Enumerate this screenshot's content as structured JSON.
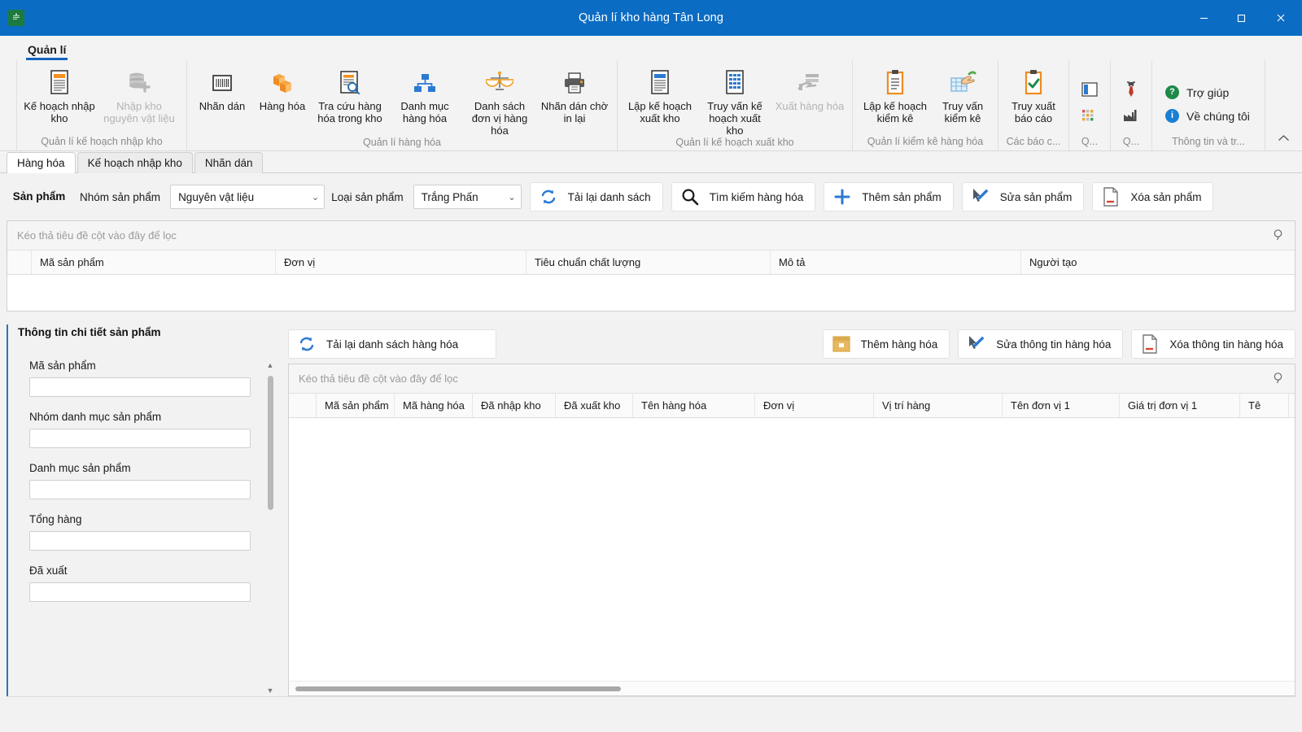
{
  "window": {
    "title": "Quản lí kho hàng Tân Long",
    "app_icon": "warehouse-app-icon",
    "minimize": "–",
    "maximize": "▢",
    "close": "✕",
    "accent": "#0b6cc4"
  },
  "ribbon": {
    "tabs": [
      {
        "label": "Quản lí",
        "active": true
      }
    ],
    "collapse_label": "^",
    "groups": [
      {
        "title": "Quản lí kế hoạch nhập kho",
        "buttons": [
          {
            "label": "Kế hoạch nhập kho",
            "icon": "document-orange-icon",
            "disabled": false
          },
          {
            "label": "Nhập kho nguyên vật liệu",
            "icon": "database-add-icon",
            "disabled": true
          }
        ]
      },
      {
        "title": "Quản lí hàng hóa",
        "buttons": [
          {
            "label": "Nhãn dán",
            "icon": "barcode-icon",
            "disabled": false
          },
          {
            "label": "Hàng hóa",
            "icon": "boxes-icon",
            "disabled": false
          },
          {
            "label": "Tra cứu hàng hóa trong kho",
            "icon": "document-search-icon",
            "disabled": false
          },
          {
            "label": "Danh mục hàng hóa",
            "icon": "hierarchy-icon",
            "disabled": false
          },
          {
            "label": "Danh sách đơn vị hàng hóa",
            "icon": "scale-balance-icon",
            "disabled": false
          },
          {
            "label": "Nhãn dán chờ in lại",
            "icon": "printer-icon",
            "disabled": false
          }
        ]
      },
      {
        "title": "Quản lí kế hoạch xuất kho",
        "buttons": [
          {
            "label": "Lập kế hoạch xuất kho",
            "icon": "document-blue-icon",
            "disabled": false
          },
          {
            "label": "Truy vấn kế hoạch xuất kho",
            "icon": "grid-document-icon",
            "disabled": false
          },
          {
            "label": "Xuất hàng hóa",
            "icon": "hand-export-icon",
            "disabled": true
          }
        ]
      },
      {
        "title": "Quản lí kiểm kê hàng hóa",
        "buttons": [
          {
            "label": "Lập kế hoạch kiểm kê",
            "icon": "clipboard-list-icon",
            "disabled": false
          },
          {
            "label": "Truy vấn kiểm kê",
            "icon": "hand-table-icon",
            "disabled": false
          }
        ]
      },
      {
        "title": "Các báo c...",
        "buttons": [
          {
            "label": "Truy xuất báo cáo",
            "icon": "clipboard-check-icon",
            "disabled": false
          }
        ]
      }
    ],
    "mini_groups": [
      {
        "title": "Q...",
        "icons": [
          "layout-panel-icon",
          "color-palette-icon"
        ]
      },
      {
        "title": "Q...",
        "icons": [
          "tie-icon",
          "factory-icon"
        ]
      }
    ],
    "info_group": {
      "title": "Thông tin và tr...",
      "items": [
        {
          "label": "Trợ giúp",
          "icon": "help-question-icon",
          "color": "#1d8a4a"
        },
        {
          "label": "Về chúng tôi",
          "icon": "info-circle-icon",
          "color": "#1a7fd4"
        }
      ]
    }
  },
  "doc_tabs": [
    {
      "label": "Hàng hóa",
      "active": true
    },
    {
      "label": "Kế hoạch nhập kho",
      "active": false
    },
    {
      "label": "Nhãn dán",
      "active": false
    }
  ],
  "product_toolbar": {
    "section_title": "Sản phẩm",
    "group_label": "Nhóm sản phẩm",
    "group_value": "Nguyên vật liệu",
    "type_label": "Loại sản phẩm",
    "type_value": "Trắng Phấn",
    "chevron": "⌄",
    "buttons": [
      {
        "label": "Tải lại danh sách",
        "icon": "refresh-icon"
      },
      {
        "label": "Tìm kiếm hàng hóa",
        "icon": "search-icon"
      },
      {
        "label": "Thêm sản phẩm",
        "icon": "plus-icon"
      },
      {
        "label": "Sửa sản phẩm",
        "icon": "edit-pencil-icon"
      },
      {
        "label": "Xóa sản phẩm",
        "icon": "delete-document-icon"
      }
    ]
  },
  "product_grid": {
    "filter_hint": "Kéo thả tiêu đề cột vào đây để lọc",
    "find_icon": "find-icon",
    "columns": [
      "Mã sản phẩm",
      "Đơn vị",
      "Tiêu chuẩn chất lượng",
      "Mô tả",
      "Người tạo"
    ],
    "rows": []
  },
  "detail_panel": {
    "title": "Thông tin chi tiết sản phẩm",
    "scroll_up": "▲",
    "scroll_down": "▼",
    "fields": [
      {
        "label": "Mã sản phẩm",
        "value": ""
      },
      {
        "label": "Nhóm danh mục sản phẩm",
        "value": ""
      },
      {
        "label": "Danh mục sản phẩm",
        "value": ""
      },
      {
        "label": "Tổng hàng",
        "value": ""
      },
      {
        "label": "Đã xuất",
        "value": ""
      }
    ]
  },
  "goods_toolbar": {
    "buttons": [
      {
        "label": "Tải lại danh sách hàng hóa",
        "icon": "refresh-icon"
      },
      {
        "label": "Thêm hàng hóa",
        "icon": "box-add-icon"
      },
      {
        "label": "Sửa thông tin hàng hóa",
        "icon": "edit-pencil-icon"
      },
      {
        "label": "Xóa thông tin hàng hóa",
        "icon": "delete-document-icon"
      }
    ]
  },
  "goods_grid": {
    "filter_hint": "Kéo thả tiêu đề cột vào đây để lọc",
    "find_icon": "find-icon",
    "columns": [
      "Mã sản phẩm",
      "Mã hàng hóa",
      "Đã nhập kho",
      "Đã xuất kho",
      "Tên hàng hóa",
      "Đơn vị",
      "Vị trí hàng",
      "Tên đơn vị 1",
      "Giá trị đơn vị 1",
      "Tê"
    ],
    "rows": []
  }
}
